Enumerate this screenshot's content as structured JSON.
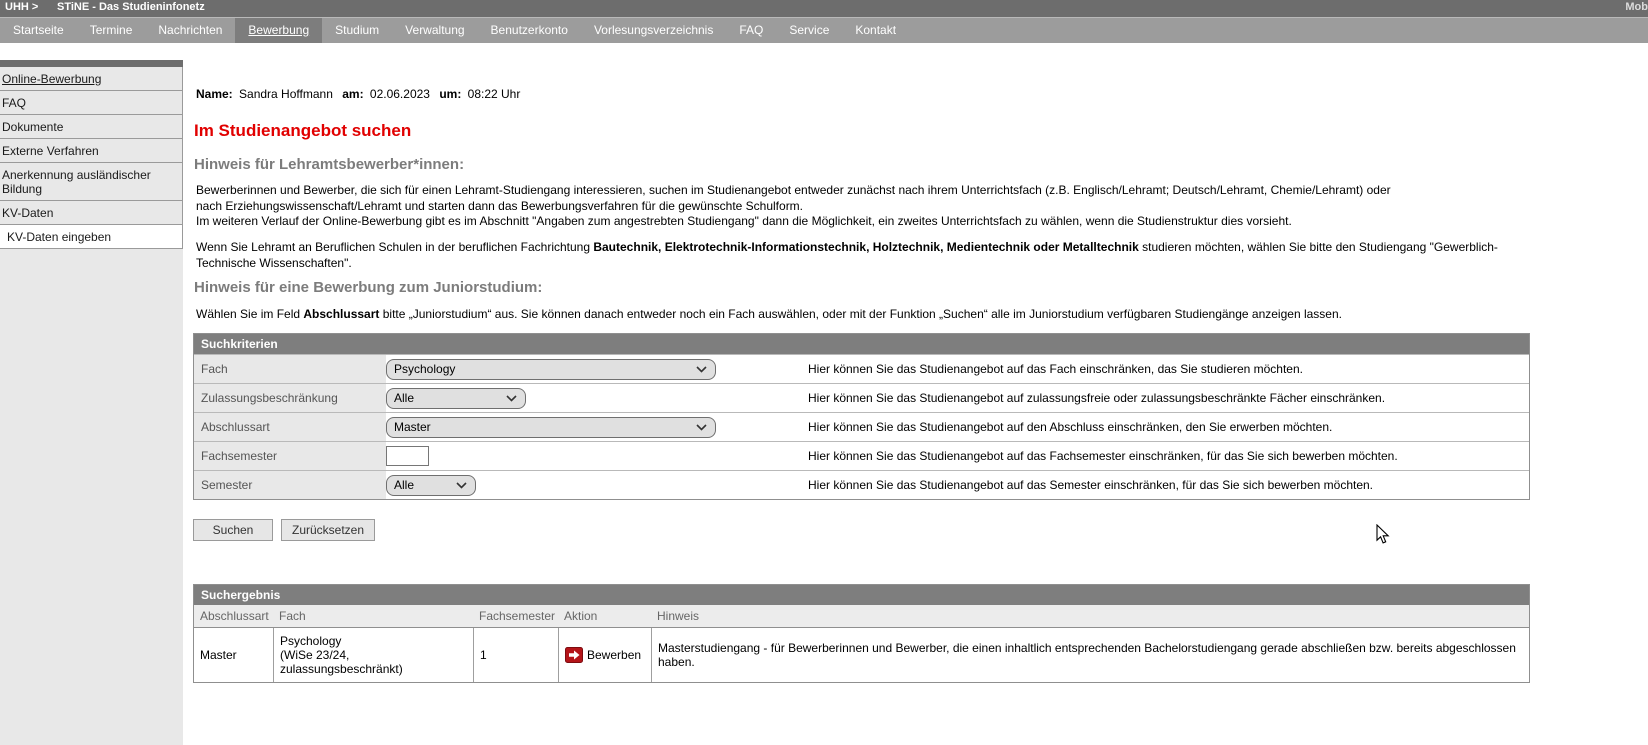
{
  "topbar": {
    "breadcrumb": "UHH >",
    "app_title": "STiNE - Das Studieninfonetz",
    "right_text": "Mob"
  },
  "nav": {
    "tabs": [
      "Startseite",
      "Termine",
      "Nachrichten",
      "Bewerbung",
      "Studium",
      "Verwaltung",
      "Benutzerkonto",
      "Vorlesungsverzeichnis",
      "FAQ",
      "Service",
      "Kontakt"
    ],
    "active_tab": "Bewerbung"
  },
  "sidebar": {
    "items": [
      "Online-Bewerbung",
      "FAQ",
      "Dokumente",
      "Externe Verfahren",
      "Anerkennung ausländischer Bildung",
      "KV-Daten",
      "KV-Daten eingeben"
    ]
  },
  "content": {
    "meta": {
      "name_label": "Name:",
      "name_value": "Sandra Hoffmann",
      "date_label": "am:",
      "date_value": "02.06.2023",
      "time_label": "um:",
      "time_value": "08:22 Uhr"
    },
    "title": "Im Studienangebot suchen",
    "lehramt": {
      "heading": "Hinweis für Lehramtsbewerber*innen:",
      "p1_line1": "Bewerberinnen und Bewerber, die sich für einen Lehramt-Studiengang interessieren, suchen im Studienangebot entweder zunächst nach ihrem Unterrichtsfach (z.B. Englisch/Lehramt; Deutsch/Lehramt, Chemie/Lehramt) oder nach Erziehungswissenschaft/Lehramt und starten dann das Bewerbungsverfahren für die gewünschte Schulform.",
      "p1_line2": "Im weiteren Verlauf der Online-Bewerbung gibt es im Abschnitt \"Angaben zum angestrebten Studiengang\" dann die Möglichkeit, ein zweites Unterrichtsfach zu wählen, wenn die Studienstruktur dies vorsieht.",
      "p2_part1": "Wenn Sie Lehramt an Beruflichen Schulen in der beruflichen Fachrichtung ",
      "p2_bold": "Bautechnik, Elektrotechnik-Informationstechnik, Holztechnik, Medientechnik oder Metalltechnik",
      "p2_part2": " studieren möchten, wählen Sie bitte den Studiengang \"Gewerblich-Technische Wissenschaften\"."
    },
    "junior": {
      "heading": "Hinweis für eine Bewerbung zum Juniorstudium:",
      "p_part1": "Wählen Sie im Feld ",
      "p_bold": "Abschlussart",
      "p_part2": " bitte „Juniorstudium“ aus. Sie können danach entweder noch ein Fach auswählen, oder mit der Funktion „Suchen“ alle im Juniorstudium verfügbaren Studiengänge anzeigen lassen."
    }
  },
  "criteria": {
    "header": "Suchkriterien",
    "rows": [
      {
        "label": "Fach",
        "value": "Psychology",
        "hint": "Hier können Sie das Studienangebot auf das Fach einschränken, das Sie studieren möchten."
      },
      {
        "label": "Zulassungsbeschränkung",
        "value": "Alle",
        "hint": "Hier können Sie das Studienangebot auf zulassungsfreie oder zulassungsbeschränkte Fächer einschränken."
      },
      {
        "label": "Abschlussart",
        "value": "Master",
        "hint": "Hier können Sie das Studienangebot auf den Abschluss einschränken, den Sie erwerben möchten."
      },
      {
        "label": "Fachsemester",
        "value": "",
        "hint": "Hier können Sie das Studienangebot auf das Fachsemester einschränken, für das Sie sich bewerben möchten."
      },
      {
        "label": "Semester",
        "value": "Alle",
        "hint": "Hier können Sie das Studienangebot auf das Semester einschränken, für das Sie sich bewerben möchten."
      }
    ],
    "search_button": "Suchen",
    "reset_button": "Zurücksetzen"
  },
  "results": {
    "header": "Suchergebnis",
    "columns": [
      "Abschlussart",
      "Fach",
      "Fachsemester",
      "Aktion",
      "Hinweis"
    ],
    "row": {
      "abschlussart": "Master",
      "fach": "Psychology\n(WiSe 23/24,\nzulassungsbeschränkt)",
      "fachsemester": "1",
      "aktion": "Bewerben",
      "hinweis": "Masterstudiengang - für Bewerberinnen und Bewerber, die einen inhaltlich entsprechenden Bachelorstudiengang gerade abschließen bzw. bereits abgeschlossen haben."
    }
  },
  "colors": {
    "accent_red": "#e10000",
    "apply_icon_red": "#b41419",
    "header_gray": "#7e7e7e"
  }
}
